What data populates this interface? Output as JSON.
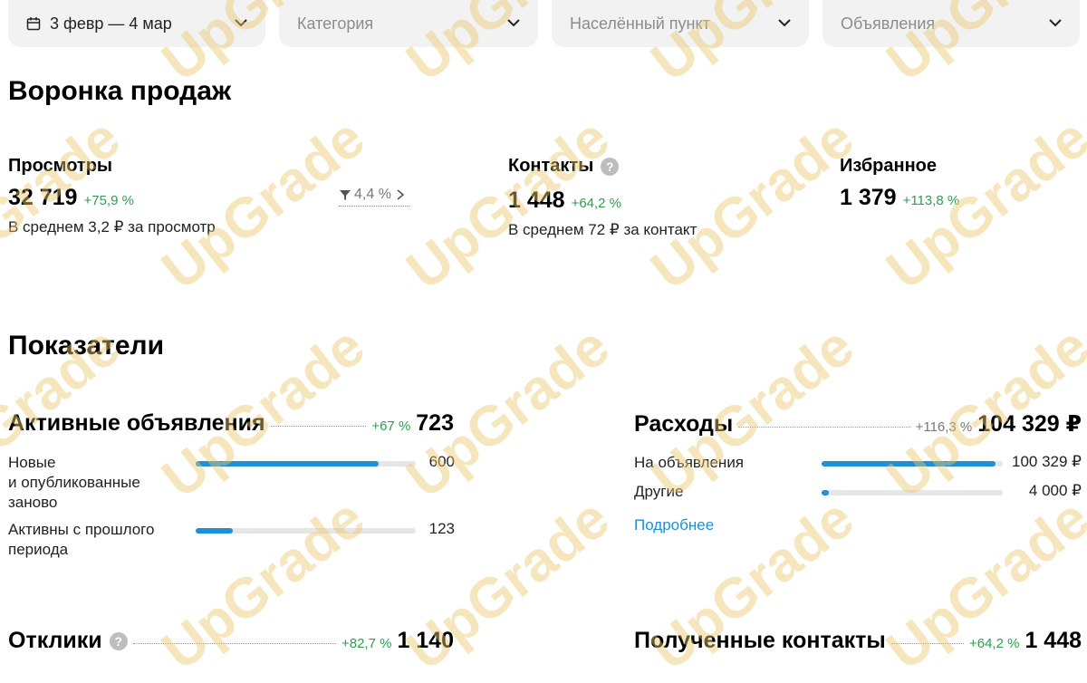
{
  "filters": {
    "period": "3 февр — 4 мар",
    "category_placeholder": "Категория",
    "city_placeholder": "Населённый пункт",
    "ads_placeholder": "Объявления"
  },
  "funnel": {
    "title": "Воронка продаж",
    "views": {
      "label": "Просмотры",
      "value": "32 719",
      "change": "+75,9 %",
      "note": "В среднем 3,2 ₽ за просмотр"
    },
    "conversion": "4,4 %",
    "contacts": {
      "label": "Контакты",
      "help": "?",
      "value": "1 448",
      "change": "+64,2 %",
      "note": "В среднем 72 ₽ за контакт"
    },
    "favorites": {
      "label": "Избранное",
      "value": "1 379",
      "change": "+113,8 %"
    }
  },
  "metrics": {
    "title": "Показатели",
    "active_ads": {
      "label": "Активные объявления",
      "change": "+67 %",
      "value": "723",
      "rows": [
        {
          "label": "Новые\nи опубликованные\nзаново",
          "value": "600",
          "fraction": 0.83
        },
        {
          "label": "Активны с прошлого\nпериода",
          "value": "123",
          "fraction": 0.17
        }
      ]
    },
    "expenses": {
      "label": "Расходы",
      "change": "+116,3 %",
      "value": "104 329 ₽",
      "rows": [
        {
          "label": "На объявления",
          "value": "100 329 ₽",
          "fraction": 0.96
        },
        {
          "label": "Другие",
          "value": "4 000 ₽",
          "fraction": 0.04
        }
      ],
      "more_link": "Подробнее"
    },
    "responses": {
      "label": "Отклики",
      "help": "?",
      "change": "+82,7 %",
      "value": "1 140"
    },
    "received_contacts": {
      "label": "Полученные контакты",
      "change": "+64,2 %",
      "value": "1 448"
    }
  },
  "watermark": "UpGrade",
  "colors": {
    "accent": "#1f8fd6",
    "positive": "#2e9e4f",
    "muted": "#777777",
    "filter_bg": "#f2f2f2",
    "bar_track": "#e6e6e6"
  },
  "icons": {
    "calendar": "calendar-icon",
    "chevron": "chevron-down-icon",
    "funnel": "funnel-icon",
    "arrow": "chevron-right-icon"
  }
}
